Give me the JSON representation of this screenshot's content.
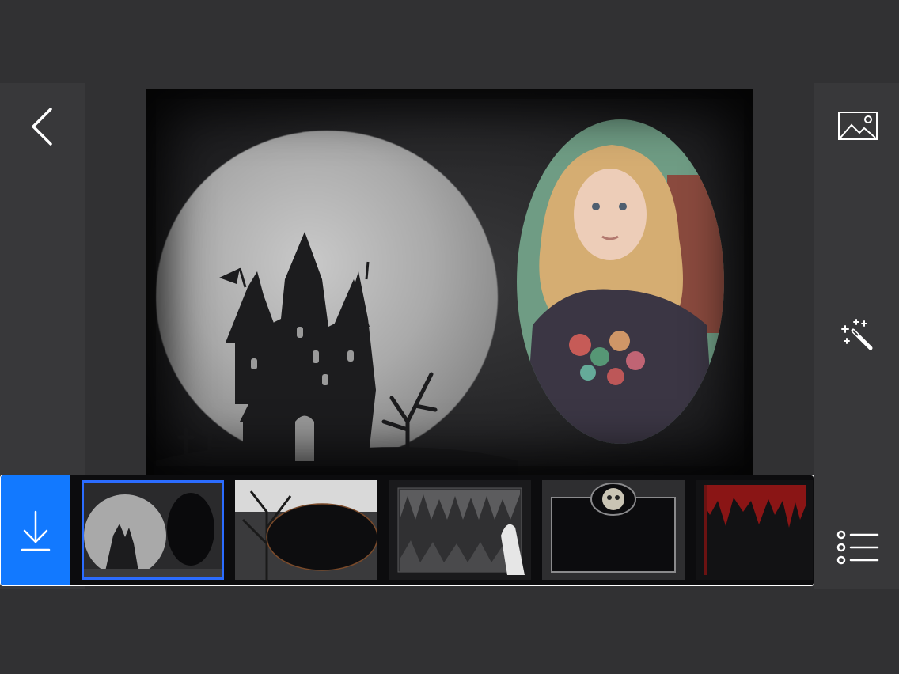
{
  "toolbar": {
    "back_icon": "chevron-left-icon",
    "gallery_icon": "image-icon",
    "effects_icon": "magic-wand-icon",
    "menu_icon": "list-icon",
    "download_icon": "download-arrow-icon"
  },
  "colors": {
    "background": "#313133",
    "side_panel": "#38383a",
    "accent": "#1279ff",
    "selection_outline": "#2b6cff"
  },
  "frames": {
    "items": [
      {
        "name": "moon-castle-frame",
        "selected": true
      },
      {
        "name": "dead-tree-frame",
        "selected": false
      },
      {
        "name": "ghost-forest-frame",
        "selected": false
      },
      {
        "name": "skull-border-frame",
        "selected": false
      },
      {
        "name": "blood-drip-frame",
        "selected": false
      }
    ]
  }
}
